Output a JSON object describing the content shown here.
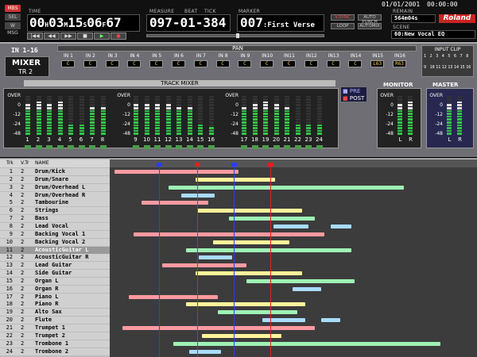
{
  "header": {
    "date": "01/01/2001",
    "clock": "00:00:00",
    "time_label": "TIME",
    "time": {
      "h": "00",
      "m": "03",
      "s": "15",
      "f": "06",
      "sf": "67"
    },
    "hms": {
      "h": "H",
      "m": "M",
      "s": "S",
      "f": "F"
    },
    "measure_label": "MEASURE",
    "beat_label": "BEAT",
    "tick_label": "TICK",
    "measure_value": "097-01-384",
    "marker_label": "MARKER",
    "marker_number": "007",
    "marker_name": ":First Verse",
    "remain_label": "REMAIN",
    "remain_value": "564m04s",
    "scene_label": "SCENE",
    "scene_value": "60:New Vocal EQ",
    "brand": "Roland",
    "left_buttons": [
      "MBS",
      "SEL",
      "W MSG"
    ],
    "flag_buttons": [
      {
        "label": "V.SYNC",
        "on": true
      },
      {
        "label": "AUTO PUNCH",
        "on": false
      },
      {
        "label": "LOOP",
        "on": false
      },
      {
        "label": "AUTOMIX",
        "on": false
      }
    ],
    "transport": [
      "|◀◀",
      "◀◀",
      "▶▶",
      "■",
      "▶",
      "●"
    ]
  },
  "mixer": {
    "section_label": "IN 1-16",
    "title": "MIXER",
    "subtitle": "TR 2",
    "pan_label": "PAN",
    "input_clip_label": "INPUT CLIP",
    "input_clip_nums": [
      "1",
      "2",
      "3",
      "4",
      "5",
      "6",
      "7",
      "8",
      "9",
      "10",
      "11",
      "12",
      "13",
      "14",
      "15",
      "16"
    ],
    "pan_channels": [
      {
        "label": "IN 1",
        "value": "C"
      },
      {
        "label": "IN 2",
        "value": "C"
      },
      {
        "label": "IN 3",
        "value": "C"
      },
      {
        "label": "IN 4",
        "value": "C"
      },
      {
        "label": "IN 5",
        "value": "C"
      },
      {
        "label": "IN 6",
        "value": "C"
      },
      {
        "label": "IN 7",
        "value": "C"
      },
      {
        "label": "IN 8",
        "value": "C"
      },
      {
        "label": "IN 9",
        "value": "C"
      },
      {
        "label": "IN10",
        "value": "C"
      },
      {
        "label": "IN11",
        "value": "C"
      },
      {
        "label": "IN12",
        "value": "C"
      },
      {
        "label": "IN13",
        "value": "C"
      },
      {
        "label": "IN14",
        "value": "C"
      },
      {
        "label": "IN15",
        "value": "L63"
      },
      {
        "label": "IN16",
        "value": "R63"
      }
    ],
    "track_mixer_label": "TRACK MIXER",
    "pre_label": "PRE",
    "post_label": "POST",
    "monitor_label": "MONITOR",
    "master_label": "MASTER",
    "scale": [
      "OVER",
      "0",
      "-12",
      "-24",
      "-48"
    ],
    "lr": [
      "L",
      "R"
    ],
    "channel_numbers": [
      "1",
      "2",
      "3",
      "4",
      "5",
      "6",
      "7",
      "8",
      "9",
      "10",
      "11",
      "12",
      "13",
      "14",
      "15",
      "16",
      "17",
      "18",
      "19",
      "20",
      "21",
      "22",
      "23",
      "24"
    ],
    "channel_levels": [
      0.82,
      0.86,
      0.78,
      0.84,
      0.3,
      0.28,
      0.7,
      0.74,
      0.8,
      0.76,
      0.82,
      0.78,
      0.74,
      0.7,
      0.25,
      0.22,
      0.72,
      0.8,
      0.86,
      0.76,
      0.7,
      0.3,
      0.28,
      0.26
    ],
    "monitor_levels": [
      0.8,
      0.84
    ],
    "master_levels": [
      0.82,
      0.86
    ]
  },
  "tracklist": {
    "col_trk": "Trk",
    "col_vtr": "V.Tr",
    "col_name": "NAME",
    "tracks": [
      {
        "n": "1",
        "v": "2",
        "name": "Drum/Kick"
      },
      {
        "n": "2",
        "v": "2",
        "name": "Drum/Snare"
      },
      {
        "n": "3",
        "v": "2",
        "name": "Drum/Overhead L"
      },
      {
        "n": "4",
        "v": "2",
        "name": "Drum/Overhead R"
      },
      {
        "n": "5",
        "v": "2",
        "name": "Tambourine"
      },
      {
        "n": "6",
        "v": "2",
        "name": "Strings"
      },
      {
        "n": "7",
        "v": "2",
        "name": "Bass"
      },
      {
        "n": "8",
        "v": "2",
        "name": "Lead Vocal"
      },
      {
        "n": "9",
        "v": "2",
        "name": "Backing Vocal 1"
      },
      {
        "n": "10",
        "v": "2",
        "name": "Backing Vocal 2"
      },
      {
        "n": "11",
        "v": "2",
        "name": "AcousticGuitar L"
      },
      {
        "n": "12",
        "v": "2",
        "name": "AcousticGuitar R"
      },
      {
        "n": "13",
        "v": "2",
        "name": "Lead Guitar"
      },
      {
        "n": "14",
        "v": "2",
        "name": "Side Guitar"
      },
      {
        "n": "15",
        "v": "2",
        "name": "Organ L"
      },
      {
        "n": "16",
        "v": "2",
        "name": "Organ R"
      },
      {
        "n": "17",
        "v": "2",
        "name": "Piano L"
      },
      {
        "n": "18",
        "v": "2",
        "name": "Piano R"
      },
      {
        "n": "19",
        "v": "2",
        "name": "Alto Sax"
      },
      {
        "n": "20",
        "v": "2",
        "name": "Flute"
      },
      {
        "n": "21",
        "v": "2",
        "name": "Trumpet 1"
      },
      {
        "n": "22",
        "v": "2",
        "name": "Trumpet 2"
      },
      {
        "n": "23",
        "v": "2",
        "name": "Trombone 1"
      },
      {
        "n": "24",
        "v": "2",
        "name": "Trombone 2"
      }
    ]
  },
  "colors": {
    "red": "#ff9aa0",
    "yellow": "#fff59a",
    "green": "#9ef2b4",
    "blue": "#a8dcff"
  }
}
